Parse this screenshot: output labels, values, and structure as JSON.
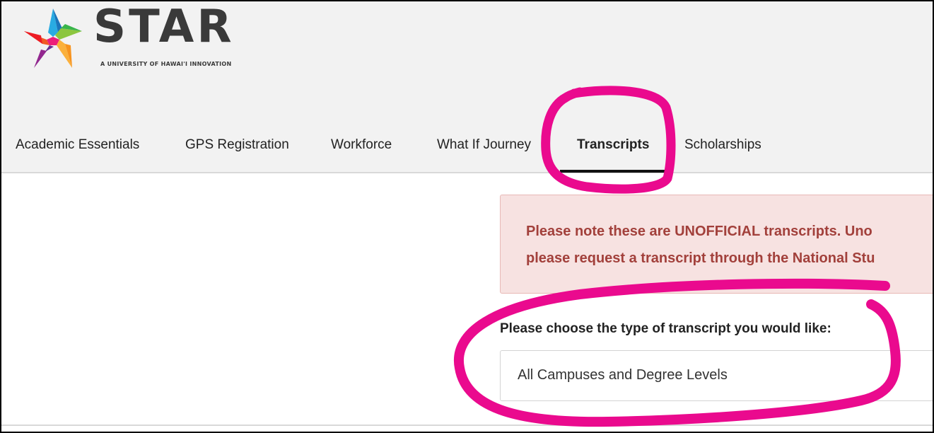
{
  "brand": {
    "name": "STAR",
    "tagline": "A UNIVERSITY OF HAWAI'I INNOVATION",
    "icon": "star-logo-icon",
    "colors": [
      "#f15a24",
      "#fbb03b",
      "#8cc63f",
      "#29abe2",
      "#662d91",
      "#ed1e79"
    ]
  },
  "nav": {
    "items": [
      {
        "label": "Academic Essentials"
      },
      {
        "label": "GPS Registration"
      },
      {
        "label": "Workforce"
      },
      {
        "label": "What If Journey"
      },
      {
        "label": "Transcripts",
        "active": true
      },
      {
        "label": "Scholarships"
      }
    ]
  },
  "alert": {
    "line1": "Please note these are UNOFFICIAL transcripts. Uno",
    "line2": "please request a transcript through the National Stu"
  },
  "transcript_type": {
    "label": "Please choose the type of transcript you would like:",
    "selected": "All Campuses and Degree Levels"
  },
  "colors": {
    "annotation": "#ea0a8e",
    "alert_text": "#a2403b",
    "alert_bg": "#f7e2e1"
  }
}
